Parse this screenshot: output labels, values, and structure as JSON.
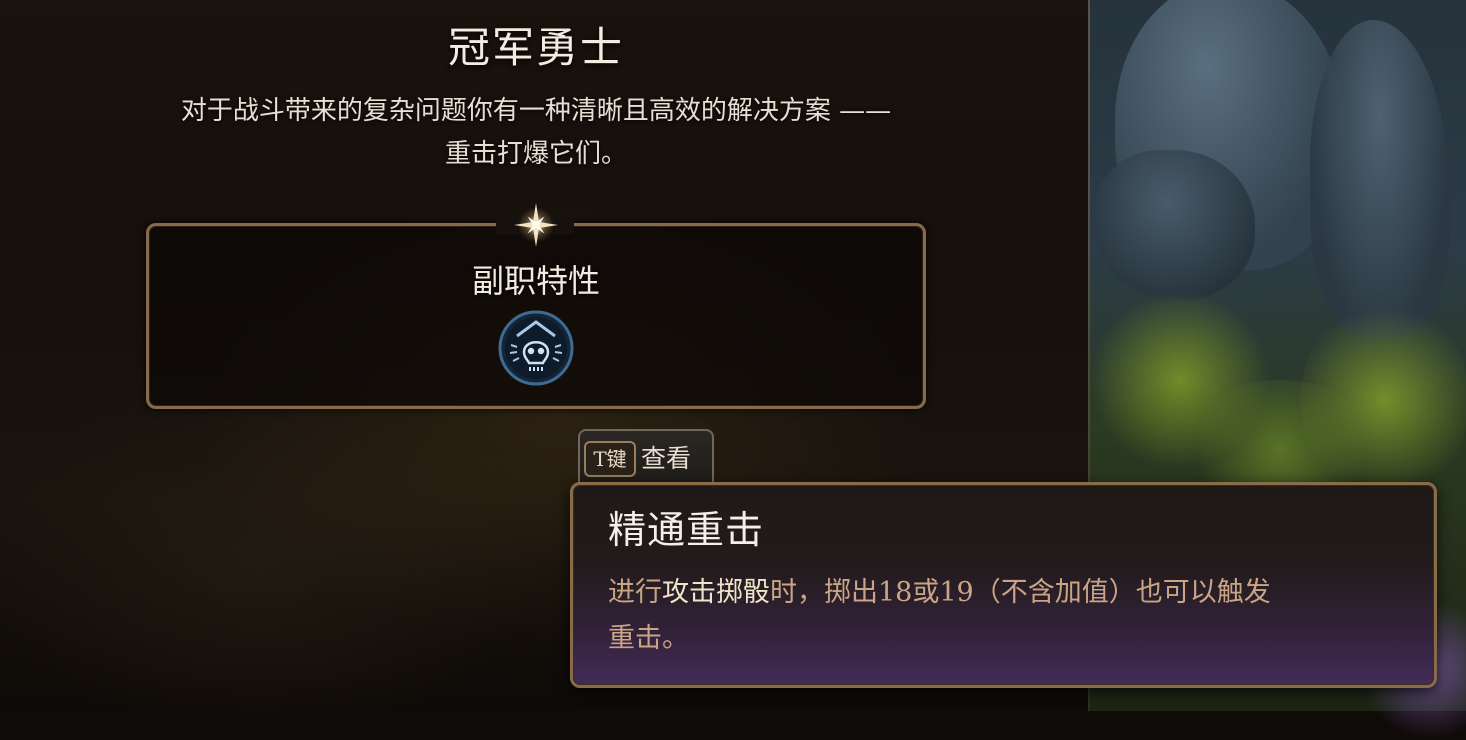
{
  "class_panel": {
    "title": "冠军勇士",
    "description_line1": "对于战斗带来的复杂问题你有一种清晰且高效的解决方案 ——",
    "description_line2": "重击打爆它们。"
  },
  "feature_box": {
    "label": "副职特性",
    "icon": "skull-icon"
  },
  "view_button": {
    "key": "T键",
    "label": "查看"
  },
  "tooltip": {
    "title": "精通重击",
    "desc_part1": "进行",
    "desc_highlight": "攻击掷骰",
    "desc_part2": "时，掷出18或19（不含加值）也可以触发",
    "desc_part3": "重击。"
  },
  "colors": {
    "frame_gold": "#876a4c",
    "tooltip_text": "#c9a585",
    "tooltip_highlight": "#f0e3c8",
    "icon_blue": "#8fb4d9"
  }
}
